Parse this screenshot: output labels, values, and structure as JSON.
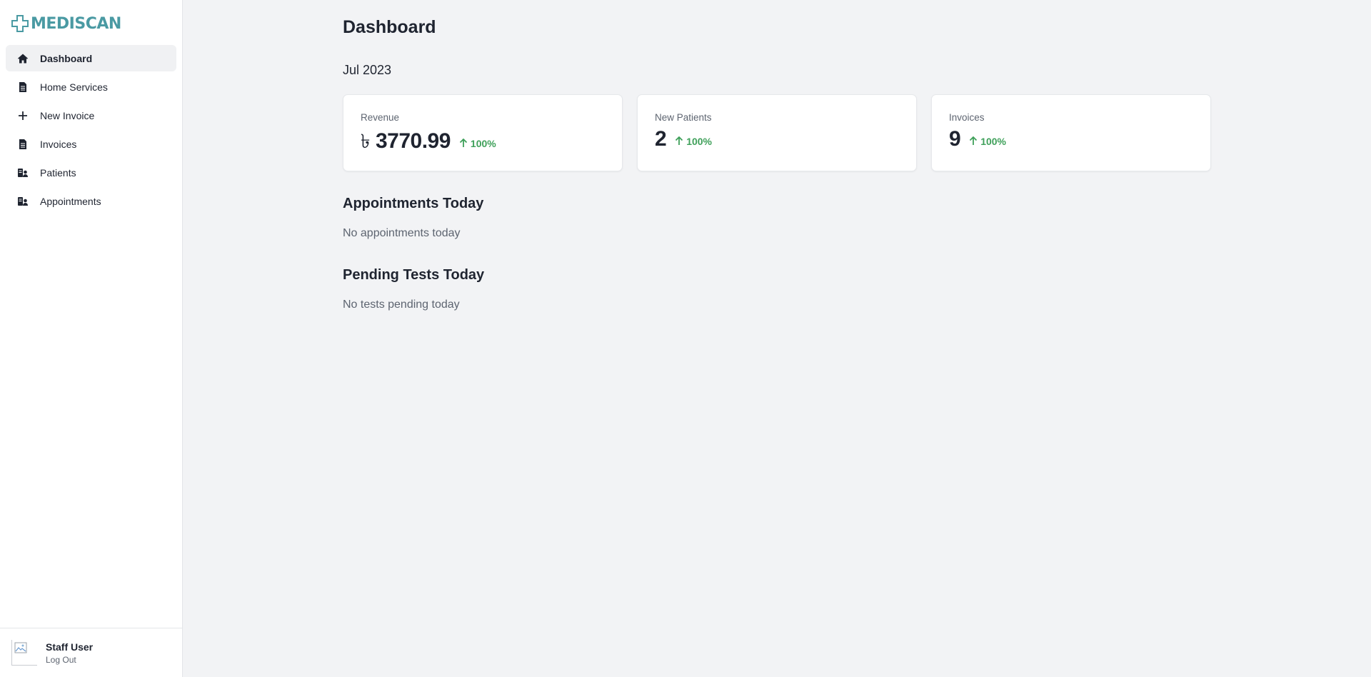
{
  "brand": {
    "name": "MEDISCAN",
    "color": "#4a9aa3"
  },
  "sidebar": {
    "items": [
      {
        "label": "Dashboard",
        "icon": "home-icon",
        "active": true
      },
      {
        "label": "Home Services",
        "icon": "document-icon"
      },
      {
        "label": "New Invoice",
        "icon": "plus-icon"
      },
      {
        "label": "Invoices",
        "icon": "document-icon"
      },
      {
        "label": "Patients",
        "icon": "patients-icon"
      },
      {
        "label": "Appointments",
        "icon": "patients-icon"
      }
    ]
  },
  "user": {
    "name": "Staff User",
    "logout_label": "Log Out"
  },
  "main": {
    "title": "Dashboard",
    "period": "Jul 2023",
    "stats": [
      {
        "label": "Revenue",
        "currency": "৳",
        "value": "3770.99",
        "change": "100%",
        "trend": "up"
      },
      {
        "label": "New Patients",
        "value": "2",
        "change": "100%",
        "trend": "up"
      },
      {
        "label": "Invoices",
        "value": "9",
        "change": "100%",
        "trend": "up"
      }
    ],
    "appointments": {
      "title": "Appointments Today",
      "empty": "No appointments today"
    },
    "pending_tests": {
      "title": "Pending Tests Today",
      "empty": "No tests pending today"
    }
  },
  "colors": {
    "positive": "#3fa05a",
    "background": "#f2f3f5"
  }
}
